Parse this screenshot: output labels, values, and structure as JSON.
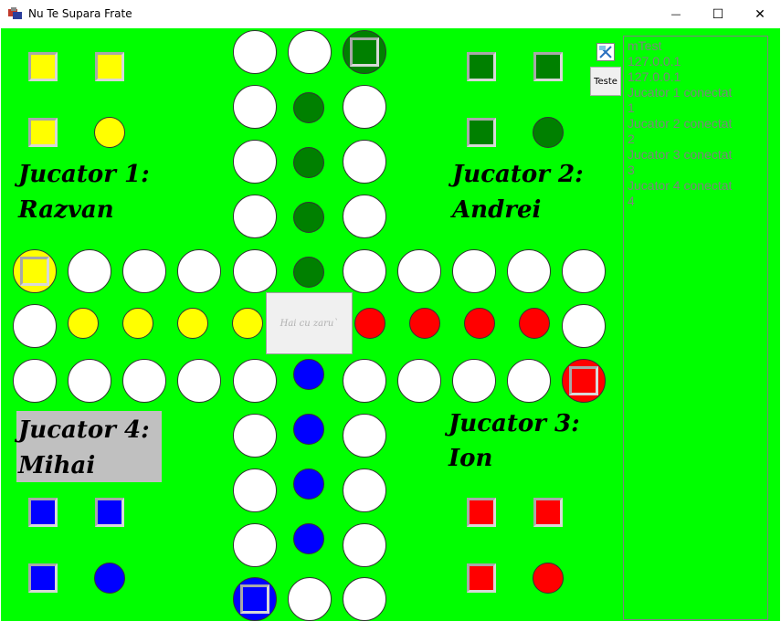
{
  "window": {
    "title": "Nu Te Supara Frate",
    "minimize_glyph": "—",
    "maximize_glyph": "☐",
    "close_glyph": "✕"
  },
  "players": {
    "p1_label": "Jucator 1:",
    "p1_name": "Razvan",
    "p2_label": "Jucator 2:",
    "p2_name": "Andrei",
    "p3_label": "Jucator 3:",
    "p3_name": "Ion",
    "p4_label": "Jucator 4:",
    "p4_name": "Mihai",
    "active_player": 4
  },
  "dice_button": {
    "label": "Hai cu zaru`"
  },
  "teste_button": {
    "label": "Teste",
    "icon": "image-icon"
  },
  "log": {
    "lines": [
      "mTest",
      "127.0.0.1",
      "127.0.0.1",
      "Jucator 1 conectat",
      "1",
      "Jucator 2 conectat",
      "2",
      "Jucator 3 conectat",
      "3",
      "Jucator 4 conectat",
      "4"
    ]
  },
  "colors": {
    "board": "#00ff00",
    "player1": "#ffff00",
    "player2": "#008000",
    "player3": "#ff0000",
    "player4": "#0000ff",
    "track": "#ffffff"
  }
}
